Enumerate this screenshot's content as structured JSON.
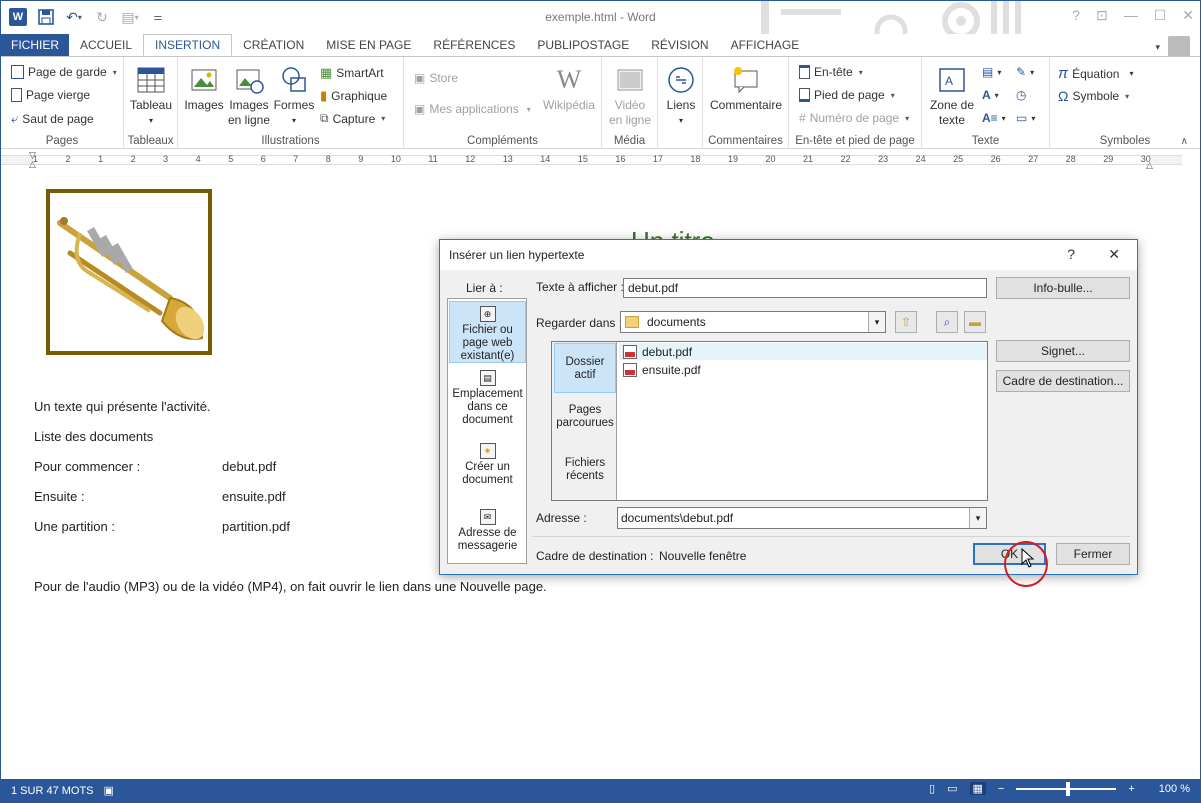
{
  "window": {
    "title": "exemple.html - Word",
    "help": "?"
  },
  "tabs": [
    "FICHIER",
    "ACCUEIL",
    "INSERTION",
    "CRÉATION",
    "MISE EN PAGE",
    "RÉFÉRENCES",
    "PUBLIPOSTAGE",
    "RÉVISION",
    "AFFICHAGE"
  ],
  "ribbon": {
    "pages": {
      "label": "Pages",
      "items": [
        "Page de garde",
        "Page vierge",
        "Saut de page"
      ]
    },
    "tableaux": {
      "label": "Tableaux",
      "tableau": "Tableau"
    },
    "illustrations": {
      "label": "Illustrations",
      "images": "Images",
      "images_en_ligne_1": "Images",
      "images_en_ligne_2": "en ligne",
      "formes": "Formes",
      "smartart": "SmartArt",
      "graphique": "Graphique",
      "capture": "Capture"
    },
    "complements": {
      "label": "Compléments",
      "store": "Store",
      "mes_applications": "Mes applications",
      "wikipedia": "Wikipédia"
    },
    "media": {
      "label": "Média",
      "video_1": "Vidéo",
      "video_2": "en ligne"
    },
    "liens": {
      "label": "Liens"
    },
    "commentaires": {
      "label": "Commentaires",
      "commentaire": "Commentaire"
    },
    "entete": {
      "label": "En-tête et pied de page",
      "entete": "En-tête",
      "pied": "Pied de page",
      "numero": "Numéro de page"
    },
    "texte": {
      "label": "Texte",
      "zone_1": "Zone de",
      "zone_2": "texte"
    },
    "symboles": {
      "label": "Symboles",
      "equation": "Équation",
      "symbole": "Symbole"
    }
  },
  "ruler": {
    "ticks": [
      "1",
      "2",
      "1",
      "2",
      "3",
      "4",
      "5",
      "6",
      "7",
      "8",
      "9",
      "10",
      "11",
      "12",
      "13",
      "14",
      "15",
      "16",
      "17",
      "18",
      "19",
      "20",
      "21",
      "22",
      "23",
      "24",
      "25",
      "26",
      "27",
      "28",
      "29",
      "30"
    ]
  },
  "document": {
    "heading": "Un titre",
    "intro": "Un texte qui présente l'activité.",
    "liste": "Liste des documents",
    "rows": [
      {
        "label": "Pour commencer :",
        "file": "debut.pdf"
      },
      {
        "label": "Ensuite :",
        "file": "ensuite.pdf"
      },
      {
        "label": "Une partition :",
        "file": "partition.pdf"
      }
    ],
    "note": "Pour de l'audio (MP3) ou de la vidéo (MP4), on fait ouvrir le lien dans une Nouvelle page."
  },
  "status": {
    "page": "1 SUR 47 MOTS",
    "zoom": "100 %"
  },
  "dialog": {
    "title": "Insérer un lien hypertexte",
    "help": "?",
    "lier_a": "Lier à :",
    "lier_items": [
      {
        "l1": "Fichier ou",
        "l2": "page web",
        "l3": "existant(e)"
      },
      {
        "l1": "Emplacement",
        "l2": "dans ce",
        "l3": "document"
      },
      {
        "l1": "Créer un",
        "l2": "document",
        "l3": ""
      },
      {
        "l1": "Adresse de",
        "l2": "messagerie",
        "l3": ""
      }
    ],
    "texte_label": "Texte à afficher :",
    "texte_value": "debut.pdf",
    "infobulle": "Info-bulle...",
    "regarder_label": "Regarder dans :",
    "regarder_value": "documents",
    "side_items": [
      {
        "l1": "Dossier",
        "l2": "actif"
      },
      {
        "l1": "Pages",
        "l2": "parcourues"
      },
      {
        "l1": "Fichiers",
        "l2": "récents"
      }
    ],
    "files": [
      "debut.pdf",
      "ensuite.pdf"
    ],
    "signet": "Signet...",
    "cadre_btn": "Cadre de destination...",
    "adresse_label": "Adresse :",
    "adresse_value": "documents\\debut.pdf",
    "cadre_label": "Cadre de destination :",
    "cadre_value": "Nouvelle fenêtre",
    "ok": "OK",
    "fermer": "Fermer"
  },
  "colors": {
    "word_blue": "#2b579a",
    "dialog_border": "#2b74c2",
    "heading_green": "#3b6f2f",
    "frame_brown": "#7a5c00",
    "highlight_red": "#d01e1e"
  }
}
